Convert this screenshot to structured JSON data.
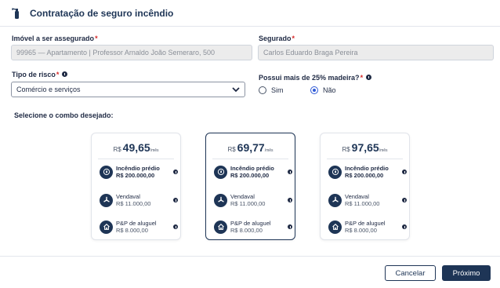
{
  "header": {
    "title": "Contratação de seguro incêndio"
  },
  "form": {
    "imovel": {
      "label": "Imóvel a ser assegurado",
      "value": "99965 — Apartamento | Professor Arnaldo João Semeraro, 500"
    },
    "segurado": {
      "label": "Segurado",
      "value": "Carlos Eduardo Braga Pereira"
    },
    "tipo_risco": {
      "label": "Tipo de risco",
      "value": "Comércio e serviços"
    },
    "madeira": {
      "label": "Possui mais de 25% madeira?",
      "options": [
        "Sim",
        "Não"
      ],
      "selected": "Não"
    },
    "required_mark": "*"
  },
  "combo": {
    "title": "Selecione o combo desejado:",
    "cards": [
      {
        "currency": "R$",
        "price": "49,65",
        "per": "/mês",
        "selected": false,
        "coverages": [
          {
            "name": "Incêndio prédio",
            "amount": "R$ 200.000,00",
            "icon": "fire-icon"
          },
          {
            "name": "Vendaval",
            "amount": "R$ 11.000,00",
            "icon": "wind-icon"
          },
          {
            "name": "P&P de aluguel",
            "amount": "R$ 8.000,00",
            "icon": "house-icon"
          }
        ]
      },
      {
        "currency": "R$",
        "price": "69,77",
        "per": "/mês",
        "selected": true,
        "coverages": [
          {
            "name": "Incêndio prédio",
            "amount": "R$ 200.000,00",
            "icon": "fire-icon"
          },
          {
            "name": "Vendaval",
            "amount": "R$ 11.000,00",
            "icon": "wind-icon"
          },
          {
            "name": "P&P de aluguel",
            "amount": "R$ 8.000,00",
            "icon": "house-icon"
          }
        ]
      },
      {
        "currency": "R$",
        "price": "97,65",
        "per": "/mês",
        "selected": false,
        "coverages": [
          {
            "name": "Incêndio prédio",
            "amount": "R$ 200.000,00",
            "icon": "fire-icon"
          },
          {
            "name": "Vendaval",
            "amount": "R$ 11.000,00",
            "icon": "wind-icon"
          },
          {
            "name": "P&P de aluguel",
            "amount": "R$ 8.000,00",
            "icon": "house-icon"
          }
        ]
      }
    ]
  },
  "footer": {
    "cancel_label": "Cancelar",
    "next_label": "Próximo"
  },
  "colors": {
    "primary": "#1e3556",
    "radio_accent": "#2f5ad6",
    "required": "#d62828"
  }
}
